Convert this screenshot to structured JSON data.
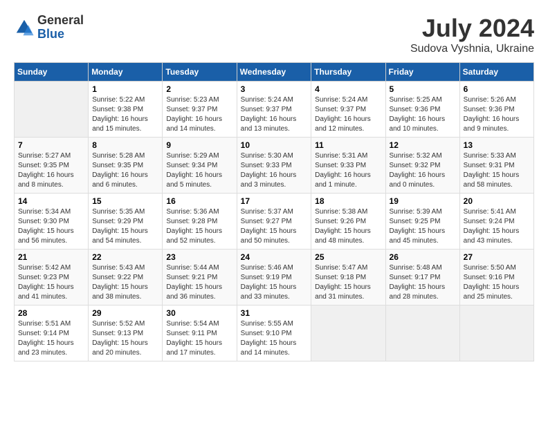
{
  "logo": {
    "general": "General",
    "blue": "Blue"
  },
  "title": "July 2024",
  "location": "Sudova Vyshnia, Ukraine",
  "days_of_week": [
    "Sunday",
    "Monday",
    "Tuesday",
    "Wednesday",
    "Thursday",
    "Friday",
    "Saturday"
  ],
  "weeks": [
    [
      {
        "day": "",
        "sunrise": "",
        "sunset": "",
        "daylight": ""
      },
      {
        "day": "1",
        "sunrise": "Sunrise: 5:22 AM",
        "sunset": "Sunset: 9:38 PM",
        "daylight": "Daylight: 16 hours and 15 minutes."
      },
      {
        "day": "2",
        "sunrise": "Sunrise: 5:23 AM",
        "sunset": "Sunset: 9:37 PM",
        "daylight": "Daylight: 16 hours and 14 minutes."
      },
      {
        "day": "3",
        "sunrise": "Sunrise: 5:24 AM",
        "sunset": "Sunset: 9:37 PM",
        "daylight": "Daylight: 16 hours and 13 minutes."
      },
      {
        "day": "4",
        "sunrise": "Sunrise: 5:24 AM",
        "sunset": "Sunset: 9:37 PM",
        "daylight": "Daylight: 16 hours and 12 minutes."
      },
      {
        "day": "5",
        "sunrise": "Sunrise: 5:25 AM",
        "sunset": "Sunset: 9:36 PM",
        "daylight": "Daylight: 16 hours and 10 minutes."
      },
      {
        "day": "6",
        "sunrise": "Sunrise: 5:26 AM",
        "sunset": "Sunset: 9:36 PM",
        "daylight": "Daylight: 16 hours and 9 minutes."
      }
    ],
    [
      {
        "day": "7",
        "sunrise": "Sunrise: 5:27 AM",
        "sunset": "Sunset: 9:35 PM",
        "daylight": "Daylight: 16 hours and 8 minutes."
      },
      {
        "day": "8",
        "sunrise": "Sunrise: 5:28 AM",
        "sunset": "Sunset: 9:35 PM",
        "daylight": "Daylight: 16 hours and 6 minutes."
      },
      {
        "day": "9",
        "sunrise": "Sunrise: 5:29 AM",
        "sunset": "Sunset: 9:34 PM",
        "daylight": "Daylight: 16 hours and 5 minutes."
      },
      {
        "day": "10",
        "sunrise": "Sunrise: 5:30 AM",
        "sunset": "Sunset: 9:33 PM",
        "daylight": "Daylight: 16 hours and 3 minutes."
      },
      {
        "day": "11",
        "sunrise": "Sunrise: 5:31 AM",
        "sunset": "Sunset: 9:33 PM",
        "daylight": "Daylight: 16 hours and 1 minute."
      },
      {
        "day": "12",
        "sunrise": "Sunrise: 5:32 AM",
        "sunset": "Sunset: 9:32 PM",
        "daylight": "Daylight: 16 hours and 0 minutes."
      },
      {
        "day": "13",
        "sunrise": "Sunrise: 5:33 AM",
        "sunset": "Sunset: 9:31 PM",
        "daylight": "Daylight: 15 hours and 58 minutes."
      }
    ],
    [
      {
        "day": "14",
        "sunrise": "Sunrise: 5:34 AM",
        "sunset": "Sunset: 9:30 PM",
        "daylight": "Daylight: 15 hours and 56 minutes."
      },
      {
        "day": "15",
        "sunrise": "Sunrise: 5:35 AM",
        "sunset": "Sunset: 9:29 PM",
        "daylight": "Daylight: 15 hours and 54 minutes."
      },
      {
        "day": "16",
        "sunrise": "Sunrise: 5:36 AM",
        "sunset": "Sunset: 9:28 PM",
        "daylight": "Daylight: 15 hours and 52 minutes."
      },
      {
        "day": "17",
        "sunrise": "Sunrise: 5:37 AM",
        "sunset": "Sunset: 9:27 PM",
        "daylight": "Daylight: 15 hours and 50 minutes."
      },
      {
        "day": "18",
        "sunrise": "Sunrise: 5:38 AM",
        "sunset": "Sunset: 9:26 PM",
        "daylight": "Daylight: 15 hours and 48 minutes."
      },
      {
        "day": "19",
        "sunrise": "Sunrise: 5:39 AM",
        "sunset": "Sunset: 9:25 PM",
        "daylight": "Daylight: 15 hours and 45 minutes."
      },
      {
        "day": "20",
        "sunrise": "Sunrise: 5:41 AM",
        "sunset": "Sunset: 9:24 PM",
        "daylight": "Daylight: 15 hours and 43 minutes."
      }
    ],
    [
      {
        "day": "21",
        "sunrise": "Sunrise: 5:42 AM",
        "sunset": "Sunset: 9:23 PM",
        "daylight": "Daylight: 15 hours and 41 minutes."
      },
      {
        "day": "22",
        "sunrise": "Sunrise: 5:43 AM",
        "sunset": "Sunset: 9:22 PM",
        "daylight": "Daylight: 15 hours and 38 minutes."
      },
      {
        "day": "23",
        "sunrise": "Sunrise: 5:44 AM",
        "sunset": "Sunset: 9:21 PM",
        "daylight": "Daylight: 15 hours and 36 minutes."
      },
      {
        "day": "24",
        "sunrise": "Sunrise: 5:46 AM",
        "sunset": "Sunset: 9:19 PM",
        "daylight": "Daylight: 15 hours and 33 minutes."
      },
      {
        "day": "25",
        "sunrise": "Sunrise: 5:47 AM",
        "sunset": "Sunset: 9:18 PM",
        "daylight": "Daylight: 15 hours and 31 minutes."
      },
      {
        "day": "26",
        "sunrise": "Sunrise: 5:48 AM",
        "sunset": "Sunset: 9:17 PM",
        "daylight": "Daylight: 15 hours and 28 minutes."
      },
      {
        "day": "27",
        "sunrise": "Sunrise: 5:50 AM",
        "sunset": "Sunset: 9:16 PM",
        "daylight": "Daylight: 15 hours and 25 minutes."
      }
    ],
    [
      {
        "day": "28",
        "sunrise": "Sunrise: 5:51 AM",
        "sunset": "Sunset: 9:14 PM",
        "daylight": "Daylight: 15 hours and 23 minutes."
      },
      {
        "day": "29",
        "sunrise": "Sunrise: 5:52 AM",
        "sunset": "Sunset: 9:13 PM",
        "daylight": "Daylight: 15 hours and 20 minutes."
      },
      {
        "day": "30",
        "sunrise": "Sunrise: 5:54 AM",
        "sunset": "Sunset: 9:11 PM",
        "daylight": "Daylight: 15 hours and 17 minutes."
      },
      {
        "day": "31",
        "sunrise": "Sunrise: 5:55 AM",
        "sunset": "Sunset: 9:10 PM",
        "daylight": "Daylight: 15 hours and 14 minutes."
      },
      {
        "day": "",
        "sunrise": "",
        "sunset": "",
        "daylight": ""
      },
      {
        "day": "",
        "sunrise": "",
        "sunset": "",
        "daylight": ""
      },
      {
        "day": "",
        "sunrise": "",
        "sunset": "",
        "daylight": ""
      }
    ]
  ]
}
